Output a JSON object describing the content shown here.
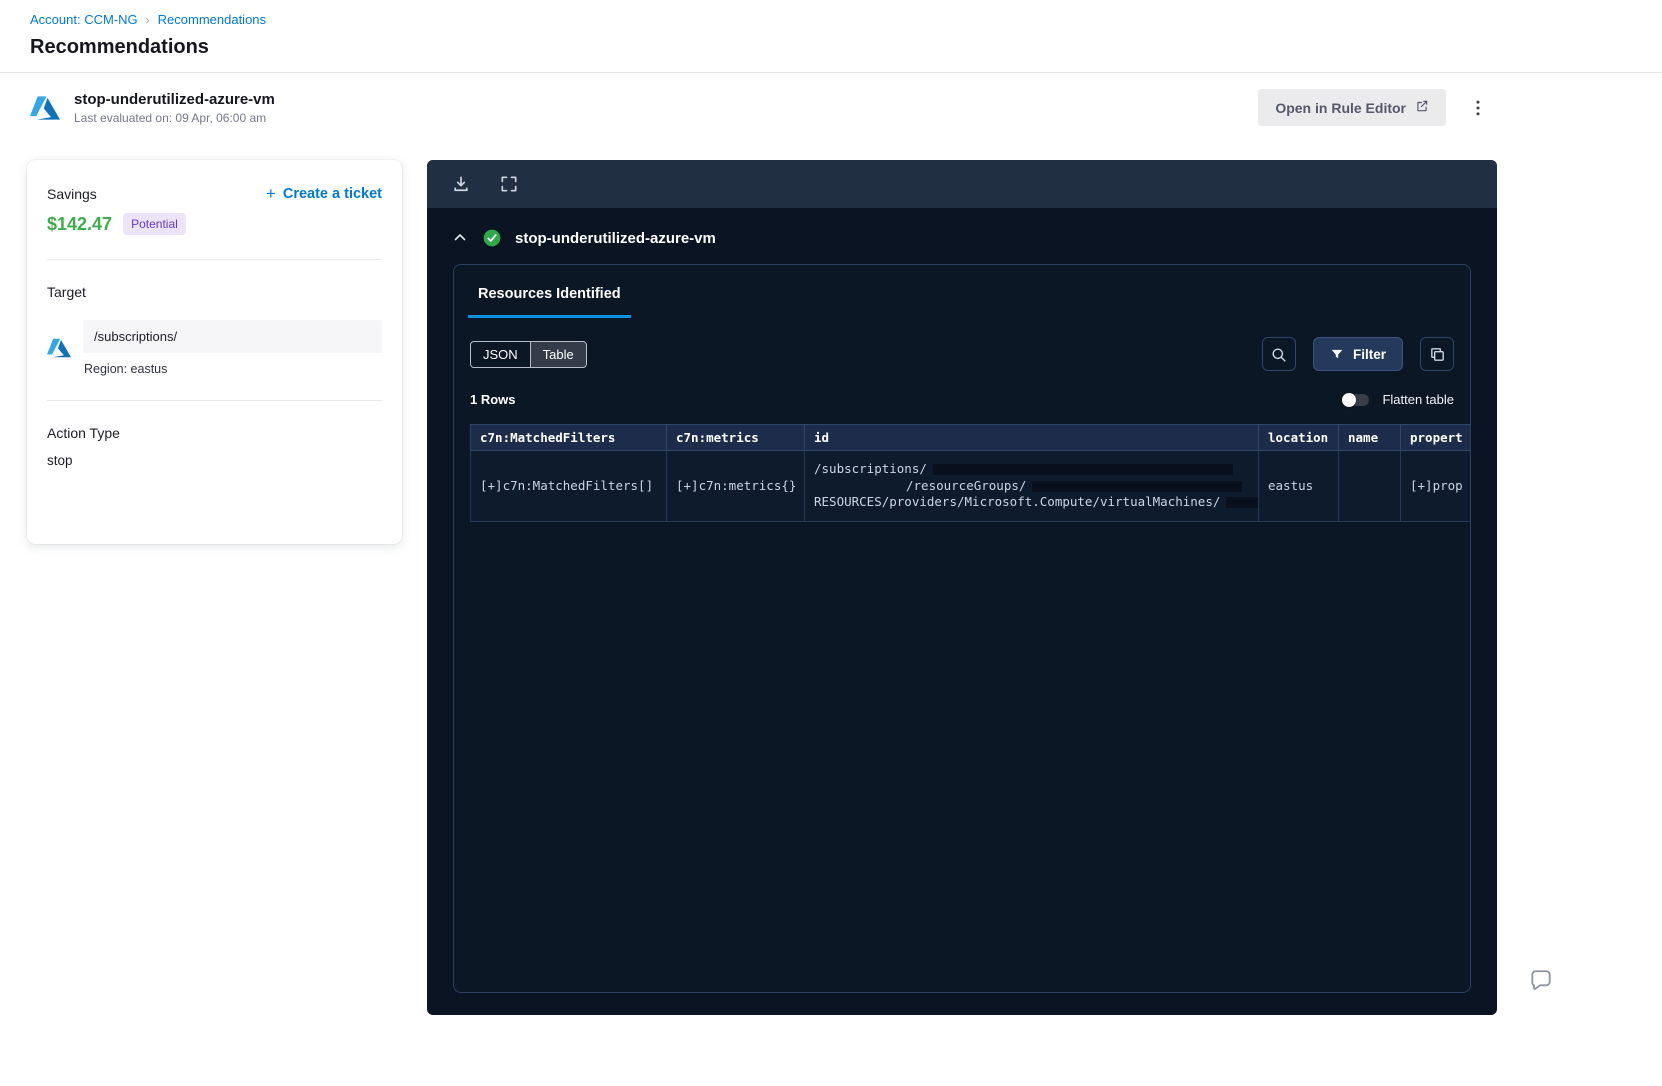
{
  "breadcrumb": {
    "account_link": "Account: CCM-NG",
    "separator": "›",
    "current": "Recommendations"
  },
  "page_title": "Recommendations",
  "rule_header": {
    "name": "stop-underutilized-azure-vm",
    "last_evaluated": "Last evaluated on: 09 Apr, 06:00 am",
    "open_in_rule_editor": "Open in Rule Editor"
  },
  "savings_card": {
    "savings_label": "Savings",
    "amount": "$142.47",
    "badge": "Potential",
    "create_ticket_plus": "+",
    "create_ticket": "Create a ticket",
    "target_label": "Target",
    "target_path": "/subscriptions/",
    "region": "Region: eastus",
    "action_type_label": "Action Type",
    "action_type_value": "stop"
  },
  "panel": {
    "rule_name": "stop-underutilized-azure-vm",
    "tab": "Resources Identified",
    "view_json": "JSON",
    "view_table": "Table",
    "selected_view": "Table",
    "filter": "Filter",
    "row_count": "1 Rows",
    "flatten_label": "Flatten table",
    "flatten_state": "off",
    "table": {
      "headers": [
        "c7n:MatchedFilters",
        "c7n:metrics",
        "id",
        "location",
        "name",
        "propert"
      ],
      "row": {
        "matched_filters": "[+]c7n:MatchedFilters[]",
        "metrics": "[+]c7n:metrics{}",
        "id_line1": "/subscriptions/",
        "id_line2": "/resourceGroups/",
        "id_line3": "RESOURCES/providers/Microsoft.Compute/virtualMachines/",
        "location": "eastus",
        "name": "",
        "properties": "[+]prop"
      }
    }
  },
  "colors": {
    "accent_blue": "#0278d5",
    "savings_green": "#3dae4b",
    "badge_bg": "#ece4fb",
    "badge_text": "#6938c0",
    "panel_bg": "#0a1422",
    "tab_underline": "#0b92e3",
    "success_green": "#2faa4a"
  }
}
